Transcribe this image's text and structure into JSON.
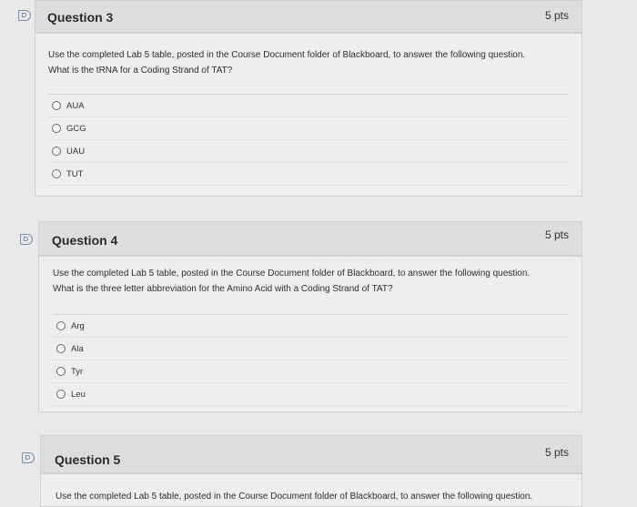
{
  "questions": [
    {
      "title": "Question 3",
      "points": "5 pts",
      "text_line1": "Use the completed Lab 5 table, posted in the Course Document folder of Blackboard, to answer the following question.",
      "text_line2": "What is the tRNA for a Coding Strand of TAT?",
      "options": [
        "AUA",
        "GCG",
        "UAU",
        "TUT"
      ]
    },
    {
      "title": "Question 4",
      "points": "5 pts",
      "text_line1": "Use the completed Lab 5 table, posted in the Course Document folder of Blackboard, to answer the following question.",
      "text_line2": "What is the three letter abbreviation for the Amino Acid with a Coding Strand of TAT?",
      "options": [
        "Arg",
        "Ala",
        "Tyr",
        "Leu"
      ]
    },
    {
      "title": "Question 5",
      "points": "5 pts",
      "text_line1": "Use the completed Lab 5 table, posted in the Course Document folder of Blackboard, to answer the following question."
    }
  ],
  "icons": {
    "flag": "bookmark-flag-icon"
  }
}
